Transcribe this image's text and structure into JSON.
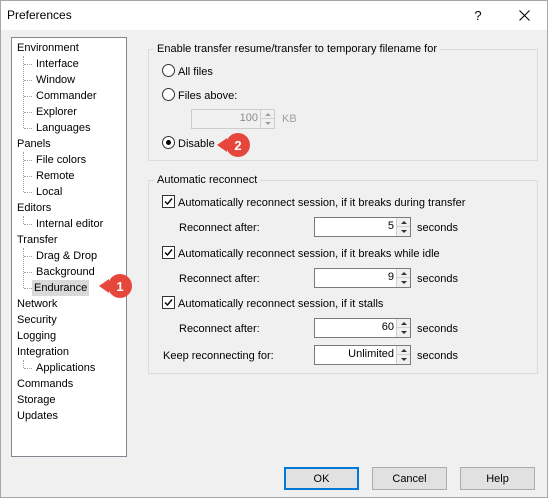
{
  "window": {
    "title": "Preferences",
    "help_glyph": "?"
  },
  "tree": {
    "items": [
      {
        "label": "Environment",
        "level": 0
      },
      {
        "label": "Interface",
        "level": 1
      },
      {
        "label": "Window",
        "level": 1
      },
      {
        "label": "Commander",
        "level": 1
      },
      {
        "label": "Explorer",
        "level": 1
      },
      {
        "label": "Languages",
        "level": 1
      },
      {
        "label": "Panels",
        "level": 0
      },
      {
        "label": "File colors",
        "level": 1
      },
      {
        "label": "Remote",
        "level": 1
      },
      {
        "label": "Local",
        "level": 1
      },
      {
        "label": "Editors",
        "level": 0
      },
      {
        "label": "Internal editor",
        "level": 1
      },
      {
        "label": "Transfer",
        "level": 0
      },
      {
        "label": "Drag & Drop",
        "level": 1
      },
      {
        "label": "Background",
        "level": 1
      },
      {
        "label": "Endurance",
        "level": 1,
        "selected": true
      },
      {
        "label": "Network",
        "level": 0
      },
      {
        "label": "Security",
        "level": 0
      },
      {
        "label": "Logging",
        "level": 0
      },
      {
        "label": "Integration",
        "level": 0
      },
      {
        "label": "Applications",
        "level": 1
      },
      {
        "label": "Commands",
        "level": 0
      },
      {
        "label": "Storage",
        "level": 0
      },
      {
        "label": "Updates",
        "level": 0
      }
    ]
  },
  "callouts": {
    "one": "1",
    "two": "2",
    "color": "#e5473c"
  },
  "resume": {
    "group_label": "Enable transfer resume/transfer to temporary filename for",
    "all_files": "All files",
    "files_above": "Files above:",
    "files_above_value": "100",
    "files_above_unit": "KB",
    "disable": "Disable",
    "selected": "disable"
  },
  "reconnect": {
    "group_label": "Automatic reconnect",
    "during_transfer": "Automatically reconnect session, if it breaks during transfer",
    "during_transfer_checked": true,
    "reconnect_after_1": "Reconnect after:",
    "value_1": "5",
    "while_idle": "Automatically reconnect session, if it breaks while idle",
    "while_idle_checked": true,
    "reconnect_after_2": "Reconnect after:",
    "value_2": "9",
    "if_stalls": "Automatically reconnect session, if it stalls",
    "if_stalls_checked": true,
    "reconnect_after_3": "Reconnect after:",
    "value_3": "60",
    "keep_reconnecting": "Keep reconnecting for:",
    "keep_value": "Unlimited",
    "unit": "seconds"
  },
  "buttons": {
    "ok": "OK",
    "cancel": "Cancel",
    "help": "Help"
  }
}
